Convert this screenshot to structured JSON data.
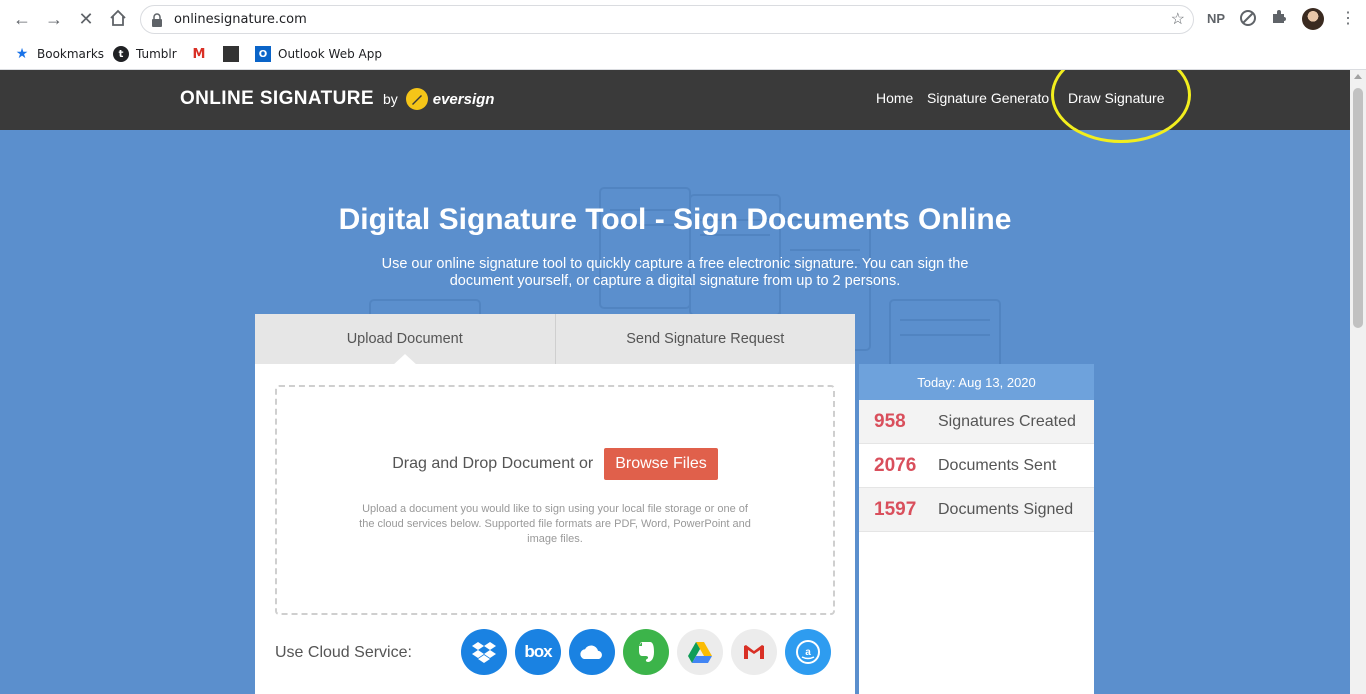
{
  "browser": {
    "url": "onlinesignature.com",
    "profile_initials": "NP",
    "bookmarks": [
      {
        "label": "Bookmarks",
        "icon": "star-icon"
      },
      {
        "label": "Tumblr",
        "icon": "tumblr-icon"
      },
      {
        "label": "",
        "icon": "gmail-icon"
      },
      {
        "label": "",
        "icon": "image-bookmark-icon"
      },
      {
        "label": "Outlook Web App",
        "icon": "outlook-icon"
      }
    ]
  },
  "site": {
    "logo": {
      "main": "ONLINE SIGNATURE",
      "by": "by",
      "brand": "eversign"
    },
    "nav": {
      "home": "Home",
      "generator": "Signature Generato",
      "draw": "Draw Signature"
    },
    "hero": {
      "title": "Digital Signature Tool - Sign Documents Online",
      "subtitle": "Use our online signature tool to quickly capture a free electronic signature. You can sign the document yourself, or capture a digital signature from up to 2 persons."
    },
    "upload": {
      "tabs": [
        "Upload Document",
        "Send Signature Request"
      ],
      "active_tab": "Upload Document",
      "drop_text": "Drag and Drop Document or",
      "browse_label": "Browse Files",
      "help_text": "Upload a document you would like to sign using your local file storage or one of the cloud services below. Supported file formats are PDF, Word, PowerPoint and image files.",
      "cloud_label": "Use Cloud Service:",
      "cloud_services": [
        {
          "name": "dropbox-icon",
          "color": "#1a82e2"
        },
        {
          "name": "box-icon",
          "color": "#1a82e2",
          "glyph": "box"
        },
        {
          "name": "onedrive-icon",
          "color": "#1a82e2"
        },
        {
          "name": "evernote-icon",
          "color": "#3cb44a"
        },
        {
          "name": "google-drive-icon",
          "color": "#ececec"
        },
        {
          "name": "gmail-icon",
          "color": "#ececec"
        },
        {
          "name": "amazon-drive-icon",
          "color": "#2e9cf0"
        }
      ]
    },
    "stats": {
      "date_label": "Today: Aug 13, 2020",
      "rows": [
        {
          "value": "958",
          "label": "Signatures Created"
        },
        {
          "value": "2076",
          "label": "Documents Sent"
        },
        {
          "value": "1597",
          "label": "Documents Signed"
        }
      ]
    }
  },
  "colors": {
    "page_bg": "#5b8fcd",
    "header_bg": "#3a3a3a",
    "accent_button": "#e0604b",
    "stat_number": "#d94f5c",
    "highlight_ring": "#f2ee1e"
  }
}
